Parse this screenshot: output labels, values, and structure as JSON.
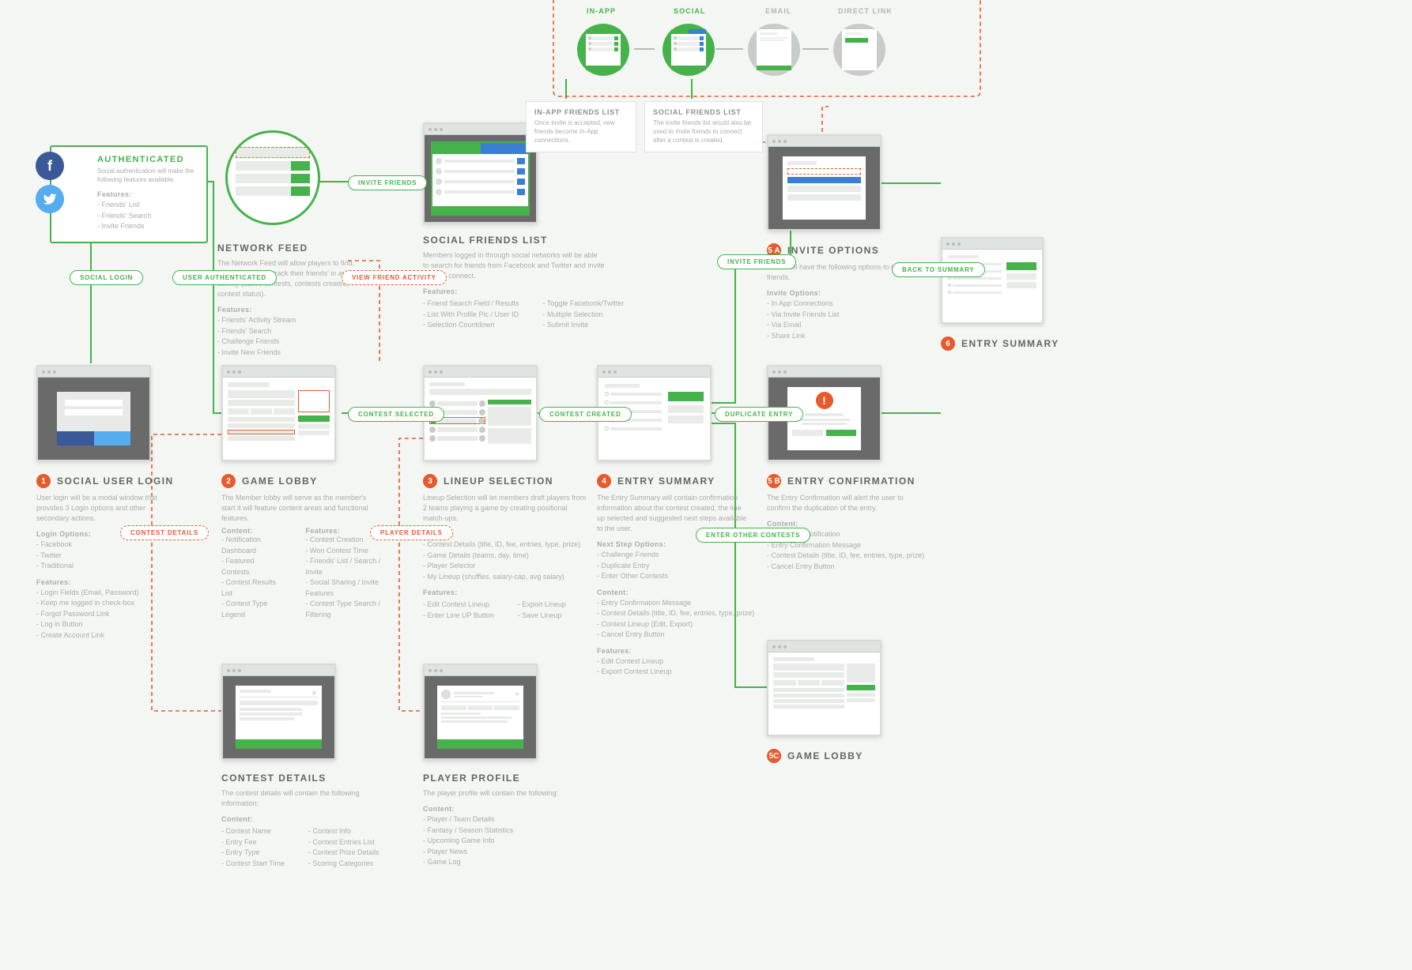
{
  "steps": {
    "s1": {
      "num": "1",
      "title": "SOCIAL USER LOGIN",
      "desc": "User login will be a modal window that provides 3 Login options and other secondary actions.",
      "labelA": "Login Options:",
      "listA": [
        "Facebook",
        "Twitter",
        "Traditional"
      ],
      "labelB": "Features:",
      "listB": [
        "Login Fields (Email, Password)",
        "Keep me logged in check-box",
        "Forgot Password Link",
        "Log in Button",
        "Create Account Link"
      ]
    },
    "s2": {
      "num": "2",
      "title": "GAME LOBBY",
      "desc": "The Member lobby will serve as the member's start it will feature content areas and functional features.",
      "labelA": "Content:",
      "listA": [
        "Notification Dashboard",
        "Featured Contests",
        "Contest Results List",
        "Contest Type Legend"
      ],
      "labelB": "Features:",
      "listB": [
        "Contest Creation",
        "Won Contest Time",
        "Friends' List / Search / Invite",
        "Social Sharing / Invite Features",
        "Contest Type Search / Filtering"
      ]
    },
    "s3": {
      "num": "3",
      "title": "LINEUP SELECTION",
      "desc": "Lineup Selection will let members draft players from 2 teams playing a game by creating positional match-ups.",
      "labelA": "Content:",
      "listA": [
        "Contest Details (title, ID, fee, entries, type, prize)",
        "Game Details (teams, day, time)",
        "Player Selector",
        "My Lineup (shuffles, salary-cap, avg salary)"
      ],
      "labelB": "Features:",
      "labelC": "",
      "listB": [
        "Edit Contest Lineup",
        "Enter Line UP Button"
      ],
      "listC": [
        "Export Lineup",
        "Save Lineup"
      ]
    },
    "s4": {
      "num": "4",
      "title": "ENTRY SUMMARY",
      "desc": "The Entry Summary will contain confirmation information about the contest created, the line up selected and suggested next steps available to the user.",
      "labelA": "Next Step Options:",
      "listA": [
        "Challenge Friends",
        "Duplicate Entry",
        "Enter Other Contests"
      ],
      "labelB": "Content:",
      "listB": [
        "Entry Confirmation Message",
        "Contest Details (title, ID, fee, entries, type, prize)",
        "Contest Lineup (Edit, Export)",
        "Cancel Entry Button"
      ],
      "labelC": "Features:",
      "listC": [
        "Edit Contest Lineup",
        "Export Contest Lineup"
      ]
    },
    "s5": {
      "num": "5 b",
      "title": "ENTRY CONFIRMATION",
      "desc": "The Entry Confirmation will alert the user to confirm the duplication of the entry.",
      "labelA": "Content:",
      "listA": [
        "Alert Type Notification",
        "Entry Confirmation Message",
        "Contest Details (title, ID, fee, entries, type, prize)",
        "Cancel Entry Button"
      ]
    },
    "s5a": {
      "num": "5 a",
      "title": "INVITE OPTIONS",
      "desc": "Users will have the following options to invite friends.",
      "labelA": "Invite Options:",
      "listA": [
        "In App Connections",
        "Via Invite Friends List",
        "Via Email",
        "Share Link"
      ]
    },
    "s5c": {
      "num": "5c",
      "title": "GAME LOBBY"
    },
    "s6": {
      "num": "6",
      "title": "ENTRY SUMMARY"
    },
    "cd": {
      "title": "CONTEST DETAILS",
      "desc": "The contest details will contain the following information:",
      "labelA": "Content:",
      "listA": [
        "Contest Name",
        "Entry Fee",
        "Entry Type",
        "Contest Start Time"
      ],
      "labelB": "",
      "listB": [
        "Contest Info",
        "Contest Entries List",
        "Contest Prize Details",
        "Scoring Categories"
      ]
    },
    "pp": {
      "title": "PLAYER PROFILE",
      "desc": "The player profile will contain the following:",
      "labelA": "Content:",
      "listA": [
        "Player / Team Details",
        "Fantasy / Season Statistics",
        "Upcoming Game Info",
        "Player News",
        "Game Log"
      ]
    },
    "nf": {
      "title": "NETWORK FEED",
      "desc": "The Network Feed will allow players to find, connect with and track their friends' in app activity (active contests, contests created, contest status).",
      "labelA": "Features:",
      "listA": [
        "Friends' Activity Stream",
        "Friends' Search",
        "Challenge Friends",
        "Invite New Friends"
      ]
    },
    "sfl": {
      "title": "SOCIAL FRIENDS LIST",
      "desc": "Members logged in through social networks will be able to search for friends from Facebook and Twitter and invite them to connect.",
      "labelA": "Features:",
      "listA": [
        "Friend Search Field / Results",
        "List With Profile Pic / User ID",
        "Selection Countdown"
      ],
      "listB": [
        "Toggle Facebook/Twitter",
        "Multiple Selection",
        "Submit Invite"
      ]
    }
  },
  "auth": {
    "title": "AUTHENTICATED",
    "sub": "Social authentication will make the following features available.",
    "label": "Features:",
    "list": [
      "Friends' List",
      "Friends' Search",
      "Invite Friends"
    ]
  },
  "inapp": {
    "title": "IN-APP FRIENDS LIST",
    "sub": "Once invite is accepted, new friends become In-App connections."
  },
  "social": {
    "title": "SOCIAL FRIENDS LIST",
    "sub": "The invite friends list would also be used to invite friends to connect after a contest is created."
  },
  "topLabels": {
    "a": "IN-APP",
    "b": "SOCIAL",
    "c": "EMAIL",
    "d": "DIRECT LINK"
  },
  "pills": {
    "sl": "SOCIAL LOGIN",
    "ua": "USER AUTHENTICATED",
    "if": "INVITE FRIENDS",
    "vfa": "VIEW FRIEND ACTIVITY",
    "cs": "CONTEST SELECTED",
    "cc": "CONTEST CREATED",
    "de": "DUPLICATE ENTRY",
    "if2": "INVITE FRIENDS",
    "eoc": "ENTER OTHER CONTESTS",
    "bts": "BACK TO SUMMARY",
    "cd": "CONTEST DETAILS",
    "pd": "PLAYER DETAILS"
  }
}
